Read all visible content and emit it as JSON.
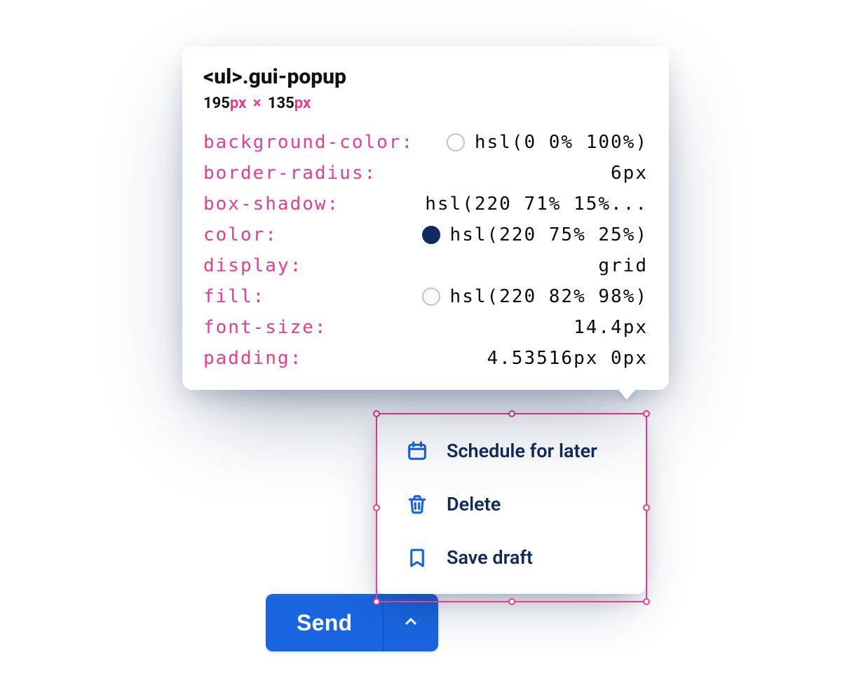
{
  "button": {
    "send_label": "Send"
  },
  "popup": {
    "items": [
      {
        "label": "Schedule for later"
      },
      {
        "label": "Delete"
      },
      {
        "label": "Save draft"
      }
    ]
  },
  "devtools": {
    "selector_tag": "<ul>",
    "selector_class": ".gui-popup",
    "dims": {
      "w": "195",
      "h": "135",
      "unit": "px"
    },
    "styles": [
      {
        "prop": "background-color",
        "value": "hsl(0 0% 100%)",
        "swatch": "#ffffff"
      },
      {
        "prop": "border-radius",
        "value": "6px"
      },
      {
        "prop": "box-shadow",
        "value": "hsl(220 71% 15%..."
      },
      {
        "prop": "color",
        "value": "hsl(220 75% 25%)",
        "swatch": "#112a62"
      },
      {
        "prop": "display",
        "value": "grid"
      },
      {
        "prop": "fill",
        "value": "hsl(220 82% 98%)",
        "swatch": "#f6f9fe"
      },
      {
        "prop": "font-size",
        "value": "14.4px"
      },
      {
        "prop": "padding",
        "value": "4.53516px 0px"
      }
    ]
  }
}
